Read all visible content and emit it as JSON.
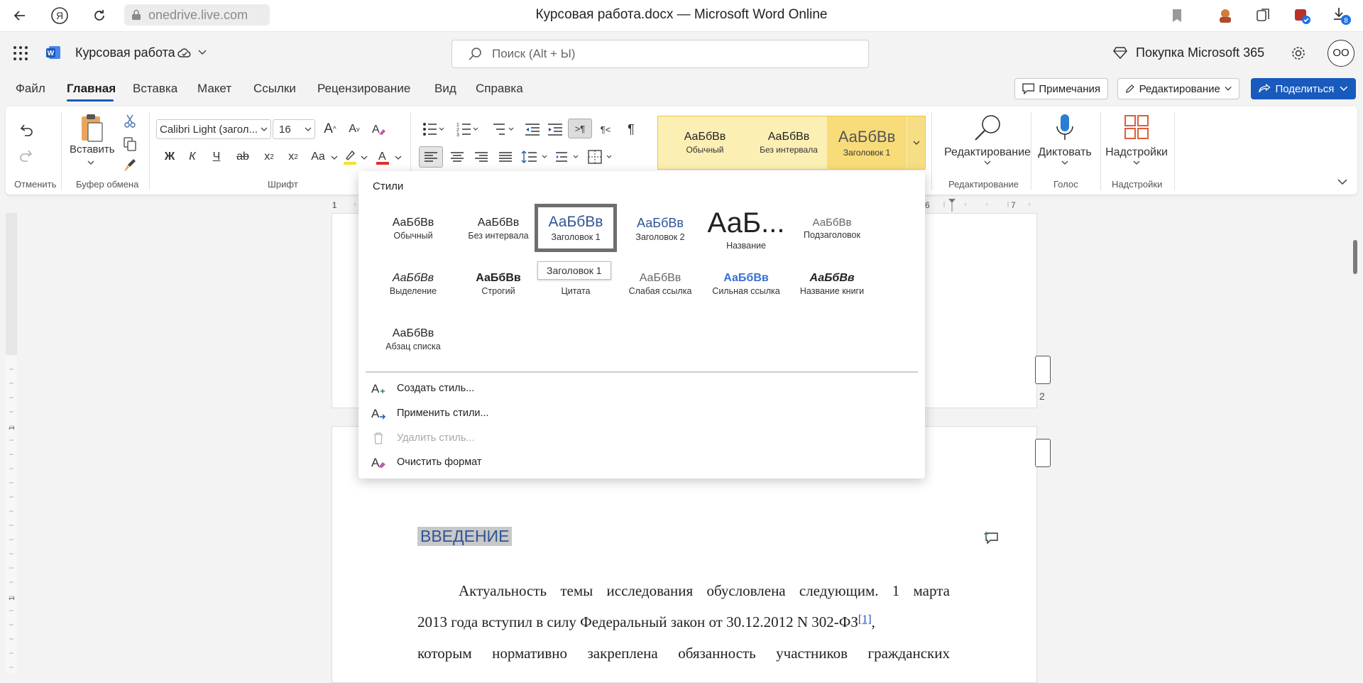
{
  "browser": {
    "address": "onedrive.live.com",
    "title": "Курсовая работа.docx — Microsoft Word Online",
    "download_badge": "8"
  },
  "app": {
    "doc_name": "Курсовая работа",
    "search_placeholder": "Поиск (Alt + Ы)",
    "buy": "Покупка Microsoft 365",
    "avatar": "OO"
  },
  "menu": {
    "tabs": [
      "Файл",
      "Главная",
      "Вставка",
      "Макет",
      "Ссылки",
      "Рецензирование",
      "Вид",
      "Справка"
    ],
    "comments": "Примечания",
    "editing": "Редактирование",
    "share": "Поделиться"
  },
  "ribbon": {
    "undo_group": "Отменить",
    "paste": "Вставить",
    "clipboard_group": "Буфер обмена",
    "font_name": "Calibri Light (загол...",
    "font_size": "16",
    "bold": "Ж",
    "italic": "К",
    "underline": "Ч",
    "strike": "ab",
    "case": "Aa",
    "font_group": "Шрифт",
    "gallery": [
      {
        "sample": "АаБбВв",
        "label": "Обычный"
      },
      {
        "sample": "АаБбВв",
        "label": "Без интервала"
      },
      {
        "sample": "АаБбВв",
        "label": "Заголовок 1"
      }
    ],
    "find": "Редактирование",
    "find_group": "Редактирование",
    "dictate": "Диктовать",
    "voice_group": "Голос",
    "addins": "Надстройки",
    "addins_group": "Надстройки"
  },
  "ruler": {
    "labels": [
      "1",
      "6",
      "7"
    ],
    "v_labels": [
      "1",
      "1"
    ]
  },
  "document": {
    "page_number": "2",
    "heading": "ВВЕДЕНИЕ",
    "line1": "Актуальность темы исследования обусловлена следующим. 1 марта",
    "line2_text": "2013 года вступил в силу Федеральный закон от 30.12.2012 N 302-ФЗ",
    "line2_ref": "[1]",
    "line2_tail": ",",
    "line3": "которым нормативно закреплена обязанность участников гражданских"
  },
  "styles_pane": {
    "title": "Стили",
    "styles": [
      {
        "sample": "АаБбВв",
        "label": "Обычный"
      },
      {
        "sample": "АаБбВв",
        "label": "Без интервала"
      },
      {
        "sample": "АаБбВв",
        "label": "Заголовок 1"
      },
      {
        "sample": "АаБбВв",
        "label": "Заголовок 2"
      },
      {
        "sample": "АаБ...",
        "label": "Название"
      },
      {
        "sample": "АаБбВв",
        "label": "Подзаголовок"
      },
      {
        "sample": "АаБбВв",
        "label": "Выделение"
      },
      {
        "sample": "АаБбВв",
        "label": "Строгий"
      },
      {
        "sample": "АаБбВв",
        "label": "Цитата"
      },
      {
        "sample": "АаБбВв",
        "label": "Слабая ссылка"
      },
      {
        "sample": "АаБбВв",
        "label": "Сильная ссылка"
      },
      {
        "sample": "АаБбВв",
        "label": "Название книги"
      },
      {
        "sample": "АаБбВв",
        "label": "Абзац списка"
      }
    ],
    "tooltip": "Заголовок 1",
    "commands": [
      {
        "label": "Создать стиль...",
        "enabled": true
      },
      {
        "label": "Применить стили...",
        "enabled": true
      },
      {
        "label": "Удалить стиль...",
        "enabled": false
      },
      {
        "label": "Очистить формат",
        "enabled": true
      }
    ]
  },
  "colors": {
    "accent": "#185abd",
    "heading_blue": "#2f5496",
    "gallery_yellow": "#fcefb4"
  }
}
